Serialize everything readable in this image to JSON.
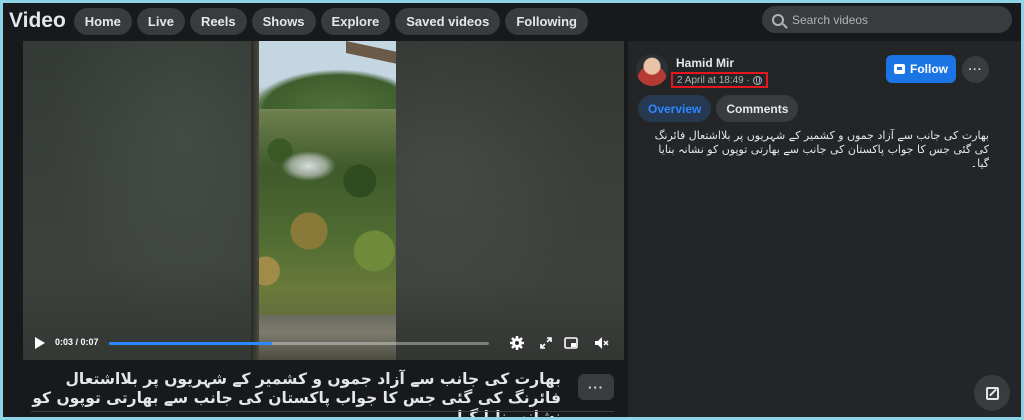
{
  "header": {
    "title": "Video",
    "nav": [
      "Home",
      "Live",
      "Reels",
      "Shows",
      "Explore",
      "Saved videos",
      "Following"
    ],
    "search_placeholder": "Search videos"
  },
  "player": {
    "time": "0:03 / 0:07",
    "progress": 0.43
  },
  "video_caption": "بھارت کی جانب سے آزاد جموں و کشمیر کے شہریوں پر بلااشتعال فائرنگ کی گئی جس کا جواب پاکستان کی جانب سے بھارتی توپوں کو نشانہ بنایا گیا۔",
  "post": {
    "author": "Hamid Mir",
    "date": "2 April at 18:49 ·",
    "follow_label": "Follow",
    "more_label": "···",
    "tabs": [
      {
        "label": "Overview",
        "active": true
      },
      {
        "label": "Comments",
        "active": false
      }
    ],
    "description": "بھارت کی جانب سے آزاد جموں و کشمیر کے شہریوں پر بلااشتعال فائرنگ کی گئی جس کا جواب پاکستان کی جانب سے بھارتی توپوں کو نشانہ بنایا گیا۔"
  },
  "colors": {
    "accent": "#1b74e4",
    "highlight_box": "#e4171f",
    "page_border": "#8fd3e6"
  }
}
